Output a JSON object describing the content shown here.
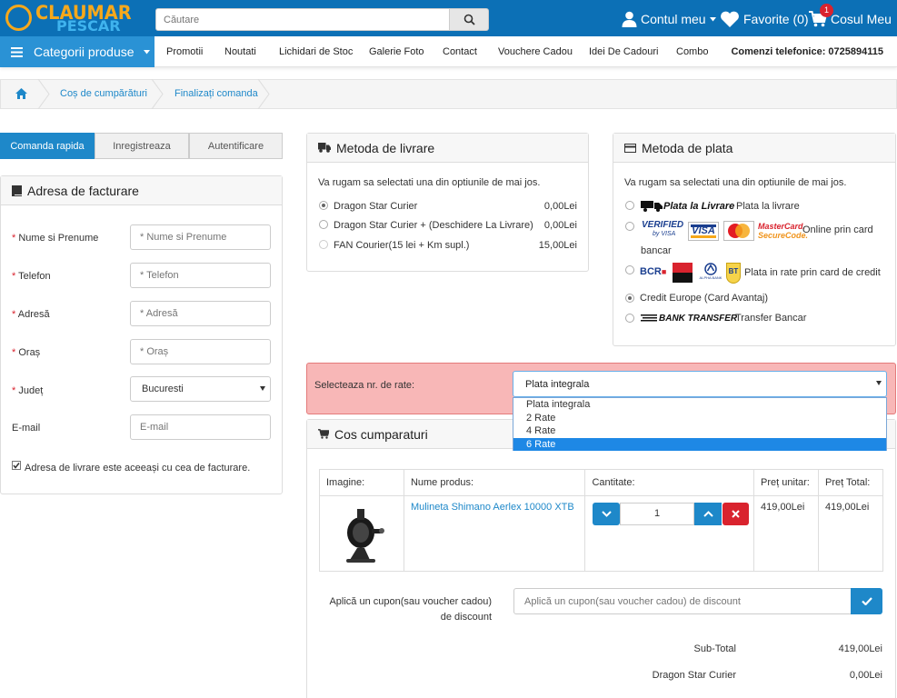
{
  "header": {
    "logo_top": "CLAUMAR",
    "logo_bottom": "PESCAR",
    "search_placeholder": "Căutare",
    "account_label": "Contul meu",
    "favorites_label": "Favorite (0)",
    "cart_label": "Cosul Meu",
    "cart_count": "1"
  },
  "nav": {
    "categories_label": "Categorii produse",
    "items": [
      "Promotii",
      "Noutati",
      "Lichidari de Stoc",
      "Galerie Foto",
      "Contact",
      "Vouchere Cadou",
      "Idei De Cadouri",
      "Combo"
    ],
    "phone": "Comenzi telefonice: 0725894115"
  },
  "breadcrumb": [
    "Coș de cumpărături",
    "Finalizați comanda"
  ],
  "tabs": [
    "Comanda rapida",
    "Inregistreaza",
    "Autentificare"
  ],
  "billing": {
    "title": "Adresa de facturare",
    "fields": [
      {
        "label": "Nume si Prenume",
        "placeholder": "* Nume si Prenume",
        "required": "*"
      },
      {
        "label": "Telefon",
        "placeholder": "* Telefon",
        "required": "*"
      },
      {
        "label": "Adresă",
        "placeholder": "* Adresă",
        "required": "*"
      },
      {
        "label": "Oraș",
        "placeholder": "* Oraș",
        "required": "*"
      },
      {
        "label": "Județ",
        "value": "Bucuresti",
        "required": "*"
      },
      {
        "label": "E-mail",
        "placeholder": "E-mail",
        "required": ""
      }
    ],
    "same_address_label": "Adresa de livrare este aceeași cu cea de facturare."
  },
  "delivery": {
    "title": "Metoda de livrare",
    "intro": "Va rugam sa selectati una din optiunile de mai jos.",
    "options": [
      {
        "label": "Dragon Star Curier",
        "price": "0,00Lei"
      },
      {
        "label": "Dragon Star Curier + (Deschidere La Livrare)",
        "price": "0,00Lei"
      },
      {
        "label": "FAN Courier(15 lei + Km supl.)",
        "price": "15,00Lei"
      }
    ]
  },
  "payment": {
    "title": "Metoda de plata",
    "intro": "Va rugam sa selectati una din optiunile de mai jos.",
    "cod_logo": "Plata la Livrare",
    "cod_label": "Plata la livrare",
    "card_label": "Online prin card",
    "card_label2": "bancar",
    "verified_1": "VERIFIED",
    "verified_2": "by VISA",
    "visa": "VISA",
    "mc_1": "MasterCard.",
    "mc_2": "SecureCode.",
    "bcr": "BCR",
    "alpha": "ALPHA BANK",
    "bt": "BT",
    "rate_label": "Plata in rate prin card de credit",
    "ce_label": "Credit Europe (Card Avantaj)",
    "bank_logo": "BANK TRANSFER",
    "bank_label": "Transfer Bancar"
  },
  "installments": {
    "label": "Selecteaza nr. de rate:",
    "selected": "Plata integrala",
    "options": [
      "Plata integrala",
      "2 Rate",
      "4 Rate",
      "6 Rate"
    ],
    "highlighted": "6 Rate"
  },
  "cart": {
    "title": "Cos cumparaturi",
    "headers": [
      "Imagine:",
      "Nume produs:",
      "Cantitate:",
      "Preț unitar:",
      "Preț Total:"
    ],
    "rows": [
      {
        "name": "Mulineta Shimano Aerlex 10000 XTB",
        "qty": "1",
        "unit_price": "419,00Lei",
        "total_price": "419,00Lei"
      }
    ],
    "coupon_label": "Aplică un cupon(sau voucher cadou) de discount",
    "coupon_placeholder": "Aplică un cupon(sau voucher cadou) de discount",
    "totals": [
      {
        "label": "Sub-Total",
        "value": "419,00Lei"
      },
      {
        "label": "Dragon Star Curier",
        "value": "0,00Lei"
      }
    ]
  },
  "colors": {
    "primary": "#0c70b6",
    "accent": "#1e88c9",
    "logo_orange": "#f6a81b",
    "alert_bg": "#f8b7b7"
  }
}
